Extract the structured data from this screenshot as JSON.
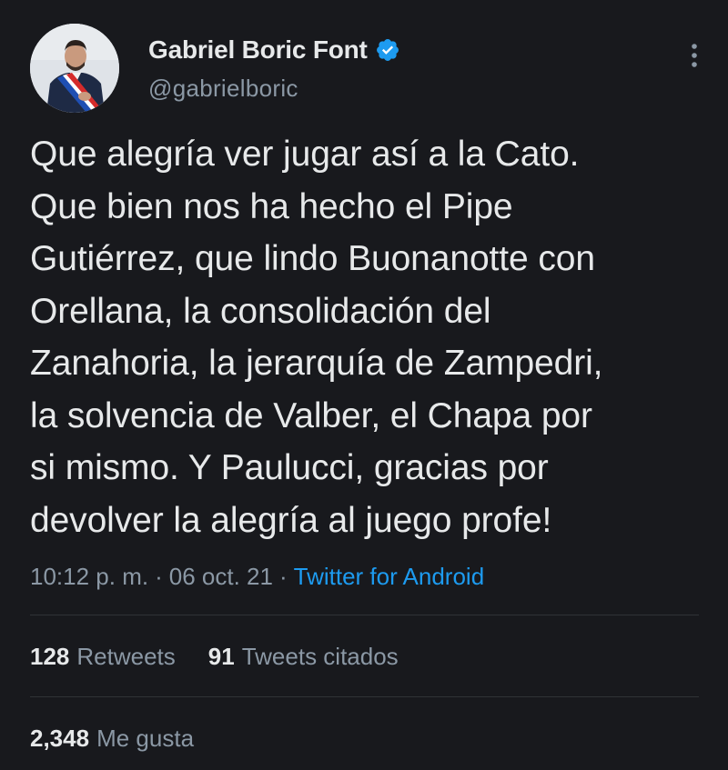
{
  "author": {
    "display_name": "Gabriel Boric Font",
    "handle": "@gabrielboric",
    "verified": true
  },
  "tweet": {
    "text": "Que alegría ver jugar así a la Cato.\nQue bien nos ha hecho el Pipe\nGutiérrez, que lindo Buonanotte con\nOrellana, la consolidación del\nZanahoria, la jerarquía de Zampedri,\nla solvencia de Valber, el Chapa por\nsi mismo. Y Paulucci, gracias por\ndevolver la alegría al juego profe!",
    "time": "10:12 p. m.",
    "separator": "·",
    "date": "06 oct. 21",
    "source": "Twitter for Android"
  },
  "stats": {
    "retweets_count": "128",
    "retweets_label": "Retweets",
    "quotes_count": "91",
    "quotes_label": "Tweets citados",
    "likes_count": "2,348",
    "likes_label": "Me gusta"
  },
  "colors": {
    "background": "#18191d",
    "text_primary": "#e7e9ea",
    "text_secondary": "#8b98a5",
    "accent": "#1d9bf0",
    "divider": "#2f3336"
  },
  "icons": {
    "verified": "verified-badge-icon",
    "more": "more-vertical-icon"
  }
}
